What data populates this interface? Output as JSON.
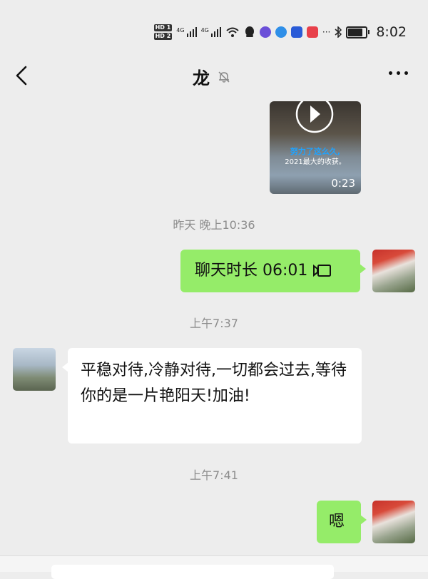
{
  "status_bar": {
    "sim1": "HD 1",
    "sim2": "HD 2",
    "network1": "4G",
    "network2": "4G",
    "time": "8:02",
    "battery_level": 0.9,
    "extra": "···"
  },
  "nav": {
    "title": "龙",
    "back_icon": "chevron-left-icon",
    "mute_icon": "bell-muted-icon",
    "more_icon": "more-dots-icon"
  },
  "messages": {
    "video": {
      "caption_line1": "努力了这么久,",
      "caption_line2": "2021最大的收获。",
      "duration": "0:23"
    },
    "ts1": "昨天 晚上10:36",
    "call": {
      "text": "聊天时长 06:01"
    },
    "ts2": "上午7:37",
    "friend_text": "平稳对待,冷静对待,一切都会过去,等待你的是一片艳阳天!加油!",
    "ts3": "上午7:41",
    "reply": "嗯"
  },
  "colors": {
    "background": "#ededed",
    "sent_bubble": "#95ec69",
    "received_bubble": "#ffffff",
    "timestamp": "#8c8c8c"
  }
}
